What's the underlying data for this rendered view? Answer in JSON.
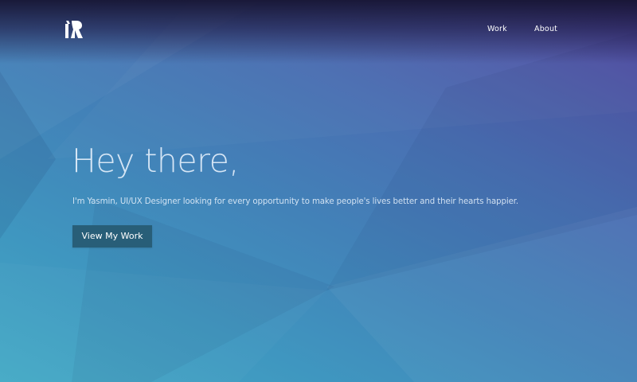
{
  "brand": {
    "logo_icon": "yr-monogram-logo"
  },
  "nav": {
    "items": [
      {
        "label": "Work"
      },
      {
        "label": "About"
      }
    ]
  },
  "hero": {
    "title": "Hey there,",
    "subtitle": "I'm Yasmin, UI/UX Designer looking for every opportunity to make people's lives better and their hearts happier.",
    "cta_label": "View My Work"
  },
  "colors": {
    "gradient_top_right": "#4f3f9e",
    "gradient_bottom_left": "#45aac6",
    "button_bg": "#285e78",
    "header_dark": "#16143a"
  }
}
